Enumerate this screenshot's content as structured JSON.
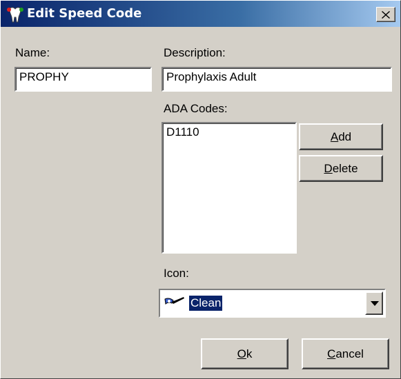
{
  "window": {
    "title": "Edit Speed Code"
  },
  "name": {
    "label": "Name:",
    "value": "PROPHY"
  },
  "description": {
    "label": "Description:",
    "value": "Prophylaxis Adult"
  },
  "ada": {
    "label": "ADA Codes:",
    "items": [
      "D1110"
    ]
  },
  "buttons": {
    "add": {
      "mnemonic": "A",
      "rest": "dd"
    },
    "delete": {
      "mnemonic": "D",
      "rest": "elete"
    },
    "ok": {
      "mnemonic": "O",
      "rest": "k"
    },
    "cancel": {
      "mnemonic": "C",
      "rest": "ancel"
    }
  },
  "icon": {
    "label": "Icon:",
    "value": "Clean",
    "icon_name": "clean-tool-icon"
  },
  "colors": {
    "title_start": "#0a246a",
    "title_end": "#a6caf0",
    "selection": "#0a246a",
    "face": "#d4d0c8"
  }
}
